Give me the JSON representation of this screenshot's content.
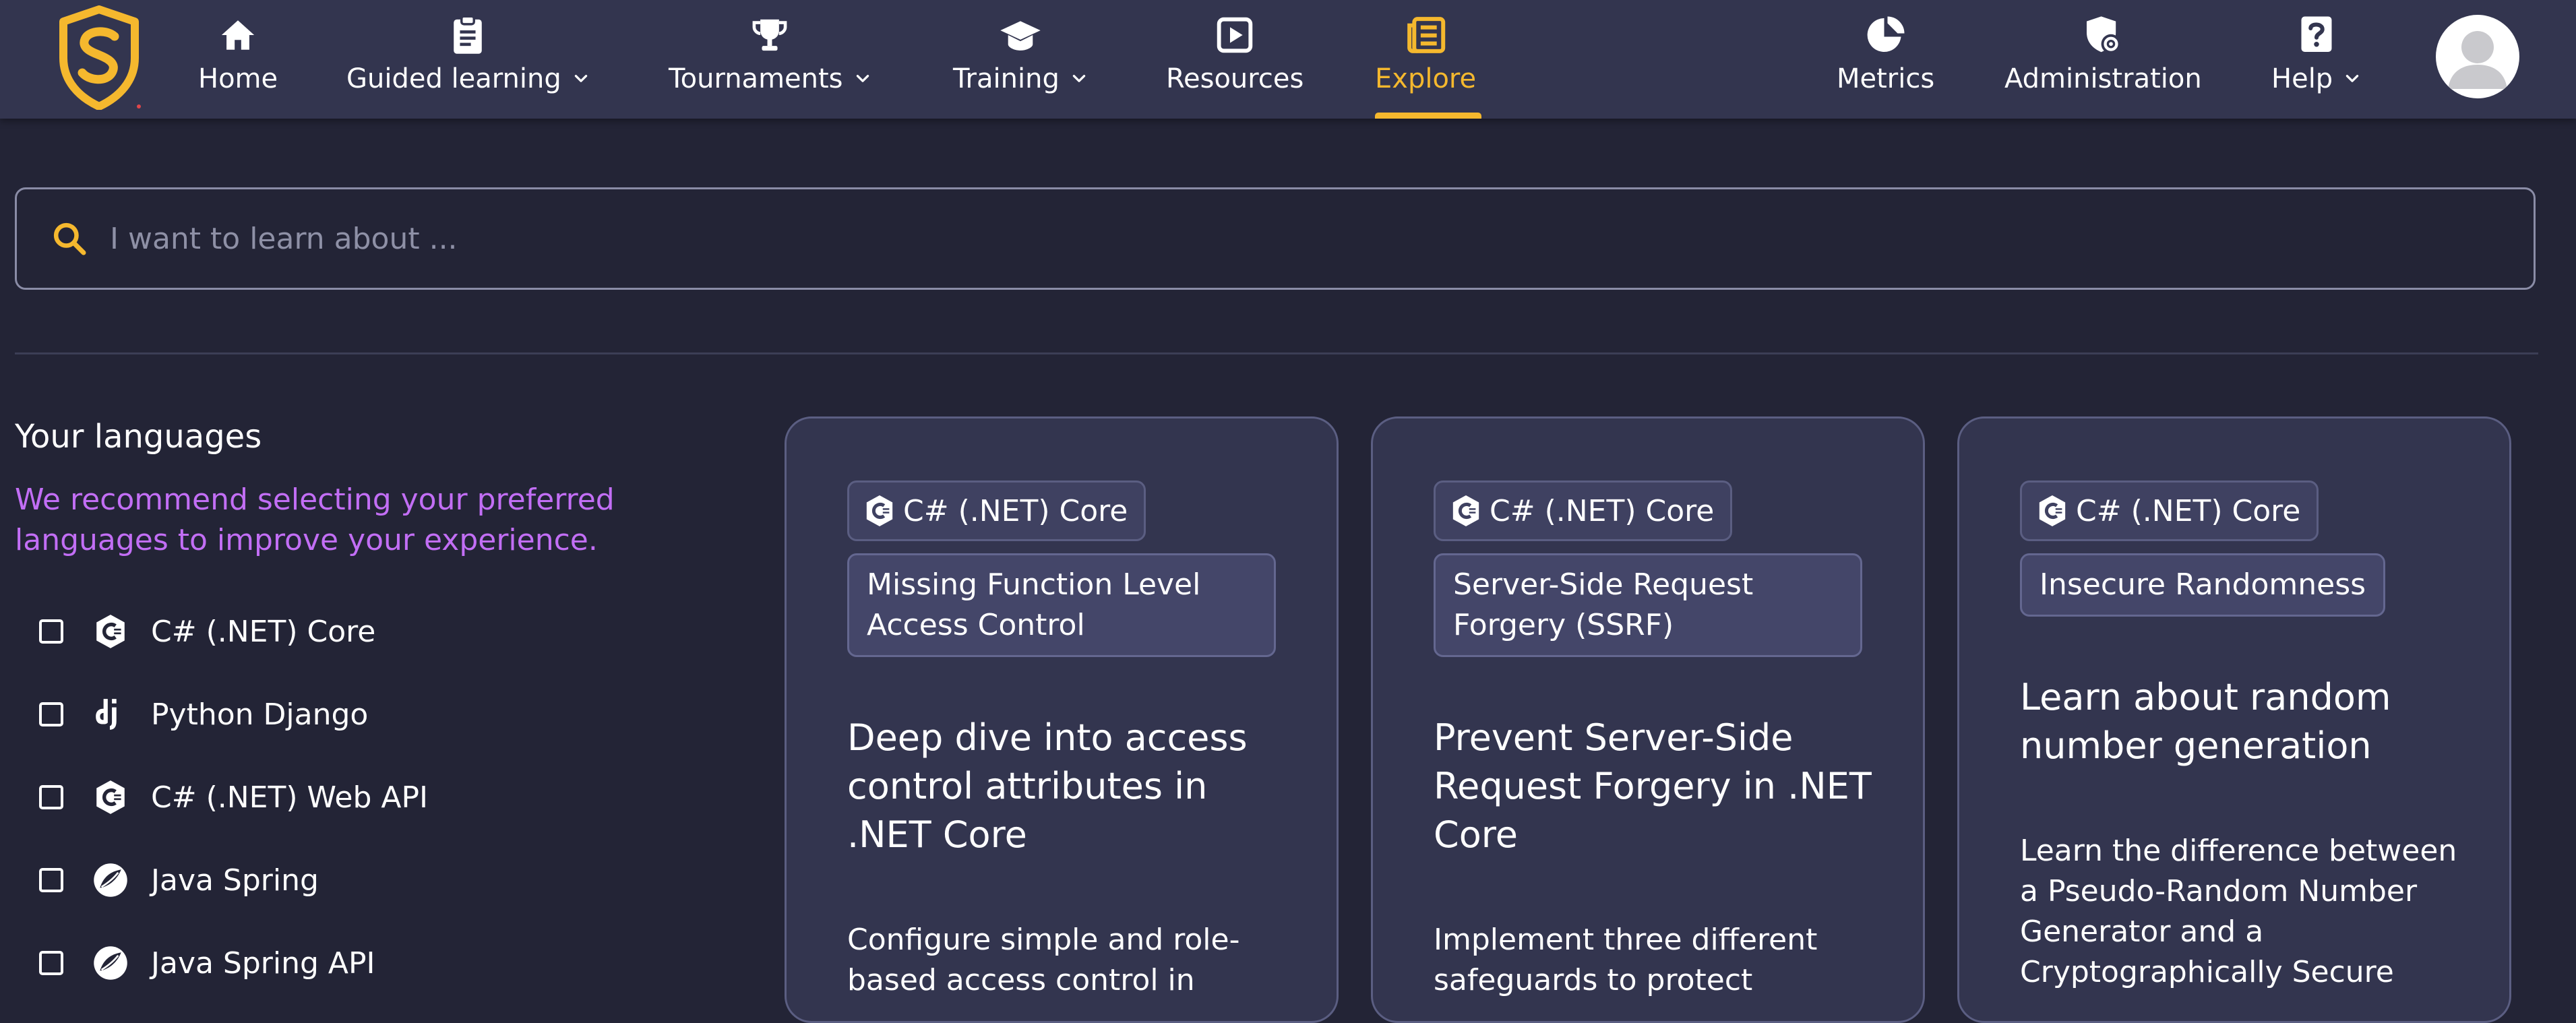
{
  "nav": {
    "items": [
      {
        "label": "Home",
        "icon": "home-icon"
      },
      {
        "label": "Guided learning",
        "icon": "clipboard-icon",
        "dropdown": true
      },
      {
        "label": "Tournaments",
        "icon": "trophy-icon",
        "dropdown": true
      },
      {
        "label": "Training",
        "icon": "graduation-cap-icon",
        "dropdown": true
      },
      {
        "label": "Resources",
        "icon": "play-square-icon"
      },
      {
        "label": "Explore",
        "icon": "newspaper-icon",
        "active": true
      },
      {
        "label": "Metrics",
        "icon": "pie-chart-icon"
      },
      {
        "label": "Administration",
        "icon": "shield-gear-icon"
      },
      {
        "label": "Help",
        "icon": "help-icon",
        "dropdown": true
      }
    ],
    "active_color": "#f5b82e"
  },
  "search": {
    "placeholder": "I want to learn about ...",
    "value": ""
  },
  "sidebar": {
    "title": "Your languages",
    "hint": "We recommend selecting your preferred languages to improve your experience.",
    "languages": [
      {
        "label": "C# (.NET) Core",
        "icon": "csharp-icon",
        "checked": false
      },
      {
        "label": "Python Django",
        "icon": "django-icon",
        "checked": false
      },
      {
        "label": "C# (.NET) Web API",
        "icon": "csharp-icon",
        "checked": false
      },
      {
        "label": "Java Spring",
        "icon": "spring-icon",
        "checked": false
      },
      {
        "label": "Java Spring API",
        "icon": "spring-icon",
        "checked": false
      }
    ]
  },
  "cards": [
    {
      "language": "C# (.NET) Core",
      "topic": "Missing Function Level Access Control",
      "title": "Deep dive into access control attributes in .NET Core",
      "description": "Configure simple and role-based access control in"
    },
    {
      "language": "C# (.NET) Core",
      "topic": "Server-Side Request Forgery (SSRF)",
      "title": "Prevent Server-Side Request Forgery in .NET Core",
      "description": "Implement three different safeguards to protect"
    },
    {
      "language": "C# (.NET) Core",
      "topic": "Insecure Randomness",
      "title": "Learn about random number generation",
      "description": "Learn the difference between a Pseudo-Random Number Generator and a Cryptographically Secure"
    }
  ]
}
